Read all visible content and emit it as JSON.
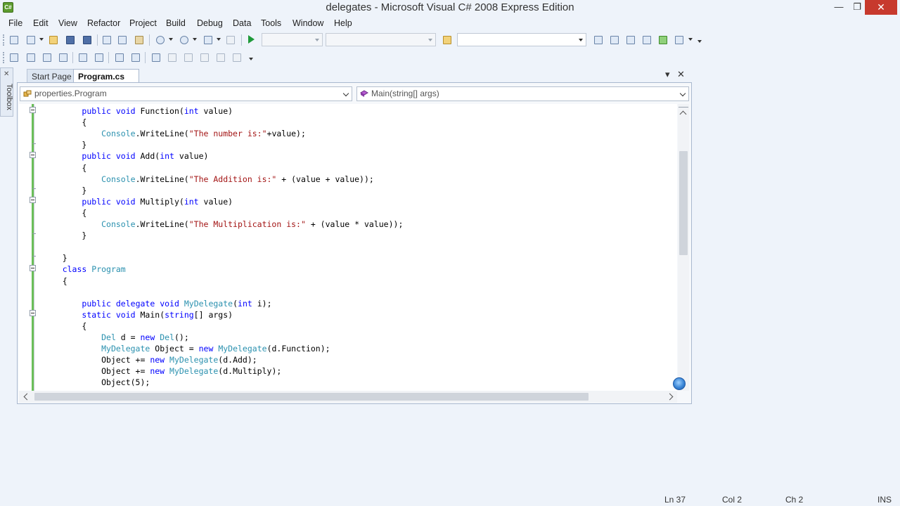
{
  "window": {
    "title": "delegates - Microsoft Visual C# 2008 Express Edition",
    "icon_label": "C#",
    "min_glyph": "—",
    "max_glyph": "❐",
    "close_glyph": "✕"
  },
  "menu": [
    "File",
    "Edit",
    "View",
    "Refactor",
    "Project",
    "Build",
    "Debug",
    "Data",
    "Tools",
    "Window",
    "Help"
  ],
  "toolbox": {
    "label": "Toolbox",
    "pin_glyph": "✕"
  },
  "tabs": {
    "start": "Start Page",
    "active": "Program.cs",
    "dropdown_glyph": "▾",
    "close_glyph": "✕"
  },
  "nav": {
    "type_combo": "properties.Program",
    "member_combo": "Main(string[] args)"
  },
  "code": [
    [
      [
        "        ",
        ""
      ],
      [
        "public",
        "kw"
      ],
      [
        " ",
        ""
      ],
      [
        "void",
        "kw"
      ],
      [
        " Function(",
        ""
      ],
      [
        "int",
        "kw"
      ],
      [
        " value)",
        ""
      ]
    ],
    [
      [
        "        {",
        ""
      ]
    ],
    [
      [
        "            ",
        ""
      ],
      [
        "Console",
        "ty"
      ],
      [
        ".WriteLine(",
        ""
      ],
      [
        "\"The number is:\"",
        "str"
      ],
      [
        "+value);",
        ""
      ]
    ],
    [
      [
        "        }",
        ""
      ]
    ],
    [
      [
        "        ",
        ""
      ],
      [
        "public",
        "kw"
      ],
      [
        " ",
        ""
      ],
      [
        "void",
        "kw"
      ],
      [
        " Add(",
        ""
      ],
      [
        "int",
        "kw"
      ],
      [
        " value)",
        ""
      ]
    ],
    [
      [
        "        {",
        ""
      ]
    ],
    [
      [
        "            ",
        ""
      ],
      [
        "Console",
        "ty"
      ],
      [
        ".WriteLine(",
        ""
      ],
      [
        "\"The Addition is:\"",
        "str"
      ],
      [
        " + (value + value));",
        ""
      ]
    ],
    [
      [
        "        }",
        ""
      ]
    ],
    [
      [
        "        ",
        ""
      ],
      [
        "public",
        "kw"
      ],
      [
        " ",
        ""
      ],
      [
        "void",
        "kw"
      ],
      [
        " Multiply(",
        ""
      ],
      [
        "int",
        "kw"
      ],
      [
        " value)",
        ""
      ]
    ],
    [
      [
        "        {",
        ""
      ]
    ],
    [
      [
        "            ",
        ""
      ],
      [
        "Console",
        "ty"
      ],
      [
        ".WriteLine(",
        ""
      ],
      [
        "\"The Multiplication is:\"",
        "str"
      ],
      [
        " + (value * value));",
        ""
      ]
    ],
    [
      [
        "        }",
        ""
      ]
    ],
    [
      [
        "",
        ""
      ]
    ],
    [
      [
        "    }",
        ""
      ]
    ],
    [
      [
        "    ",
        ""
      ],
      [
        "class",
        "kw"
      ],
      [
        " ",
        ""
      ],
      [
        "Program",
        "ty"
      ]
    ],
    [
      [
        "    {",
        ""
      ]
    ],
    [
      [
        "",
        ""
      ]
    ],
    [
      [
        "        ",
        ""
      ],
      [
        "public",
        "kw"
      ],
      [
        " ",
        ""
      ],
      [
        "delegate",
        "kw"
      ],
      [
        " ",
        ""
      ],
      [
        "void",
        "kw"
      ],
      [
        " ",
        ""
      ],
      [
        "MyDelegate",
        "ty"
      ],
      [
        "(",
        ""
      ],
      [
        "int",
        "kw"
      ],
      [
        " i);",
        ""
      ]
    ],
    [
      [
        "        ",
        ""
      ],
      [
        "static",
        "kw"
      ],
      [
        " ",
        ""
      ],
      [
        "void",
        "kw"
      ],
      [
        " Main(",
        ""
      ],
      [
        "string",
        "kw"
      ],
      [
        "[] args)",
        ""
      ]
    ],
    [
      [
        "        {",
        ""
      ]
    ],
    [
      [
        "            ",
        ""
      ],
      [
        "Del",
        "ty"
      ],
      [
        " d = ",
        ""
      ],
      [
        "new",
        "kw"
      ],
      [
        " ",
        ""
      ],
      [
        "Del",
        "ty"
      ],
      [
        "();",
        ""
      ]
    ],
    [
      [
        "            ",
        ""
      ],
      [
        "MyDelegate",
        "ty"
      ],
      [
        " Object = ",
        ""
      ],
      [
        "new",
        "kw"
      ],
      [
        " ",
        ""
      ],
      [
        "MyDelegate",
        "ty"
      ],
      [
        "(d.Function);",
        ""
      ]
    ],
    [
      [
        "            Object += ",
        ""
      ],
      [
        "new",
        "kw"
      ],
      [
        " ",
        ""
      ],
      [
        "MyDelegate",
        "ty"
      ],
      [
        "(d.Add);",
        ""
      ]
    ],
    [
      [
        "            Object += ",
        ""
      ],
      [
        "new",
        "kw"
      ],
      [
        " ",
        ""
      ],
      [
        "MyDelegate",
        "ty"
      ],
      [
        "(d.Multiply);",
        ""
      ]
    ],
    [
      [
        "            Object(5);",
        ""
      ]
    ]
  ],
  "status": {
    "ln": "Ln 37",
    "col": "Col 2",
    "ch": "Ch 2",
    "mode": "INS"
  },
  "colors": {
    "keyword": "#0000ff",
    "type": "#2b91af",
    "string": "#a31515",
    "change_bar": "#6bbf59",
    "close_button": "#c7392d"
  }
}
